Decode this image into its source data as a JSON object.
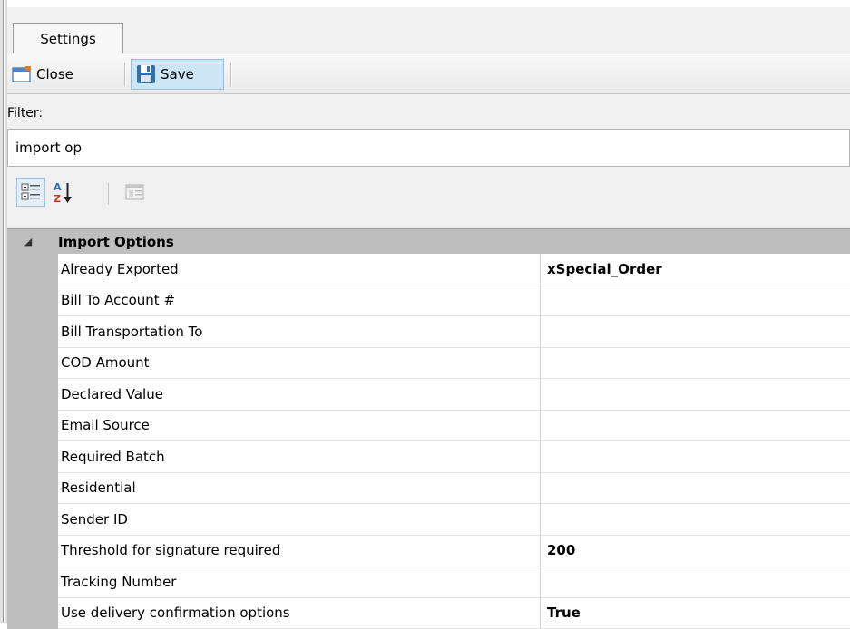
{
  "tab": {
    "label": "Settings"
  },
  "toolbar": {
    "close_label": "Close",
    "close_icon": "window-close-icon",
    "save_label": "Save",
    "save_icon": "floppy-disk-icon"
  },
  "filter": {
    "label": "Filter:",
    "value": "import op"
  },
  "grid_toolbar": {
    "categorized_icon": "categorized-view-icon",
    "alphabetical_icon": "sort-az-icon",
    "property_pages_icon": "property-pages-icon"
  },
  "grid": {
    "category": "Import Options",
    "expander_glyph": "◢",
    "properties": [
      {
        "name": "Already Exported",
        "value": "xSpecial_Order"
      },
      {
        "name": "Bill To Account #",
        "value": ""
      },
      {
        "name": "Bill Transportation To",
        "value": ""
      },
      {
        "name": "COD Amount",
        "value": ""
      },
      {
        "name": "Declared Value",
        "value": ""
      },
      {
        "name": "Email Source",
        "value": ""
      },
      {
        "name": "Required Batch",
        "value": ""
      },
      {
        "name": "Residential",
        "value": ""
      },
      {
        "name": "Sender ID",
        "value": ""
      },
      {
        "name": "Threshold for signature required",
        "value": "200"
      },
      {
        "name": "Tracking Number",
        "value": ""
      },
      {
        "name": "Use delivery confirmation options",
        "value": "True"
      }
    ]
  },
  "colors": {
    "category_band": "#bdbdbd",
    "save_highlight": "#cde6f7",
    "panel_background": "#f0f0f0"
  }
}
